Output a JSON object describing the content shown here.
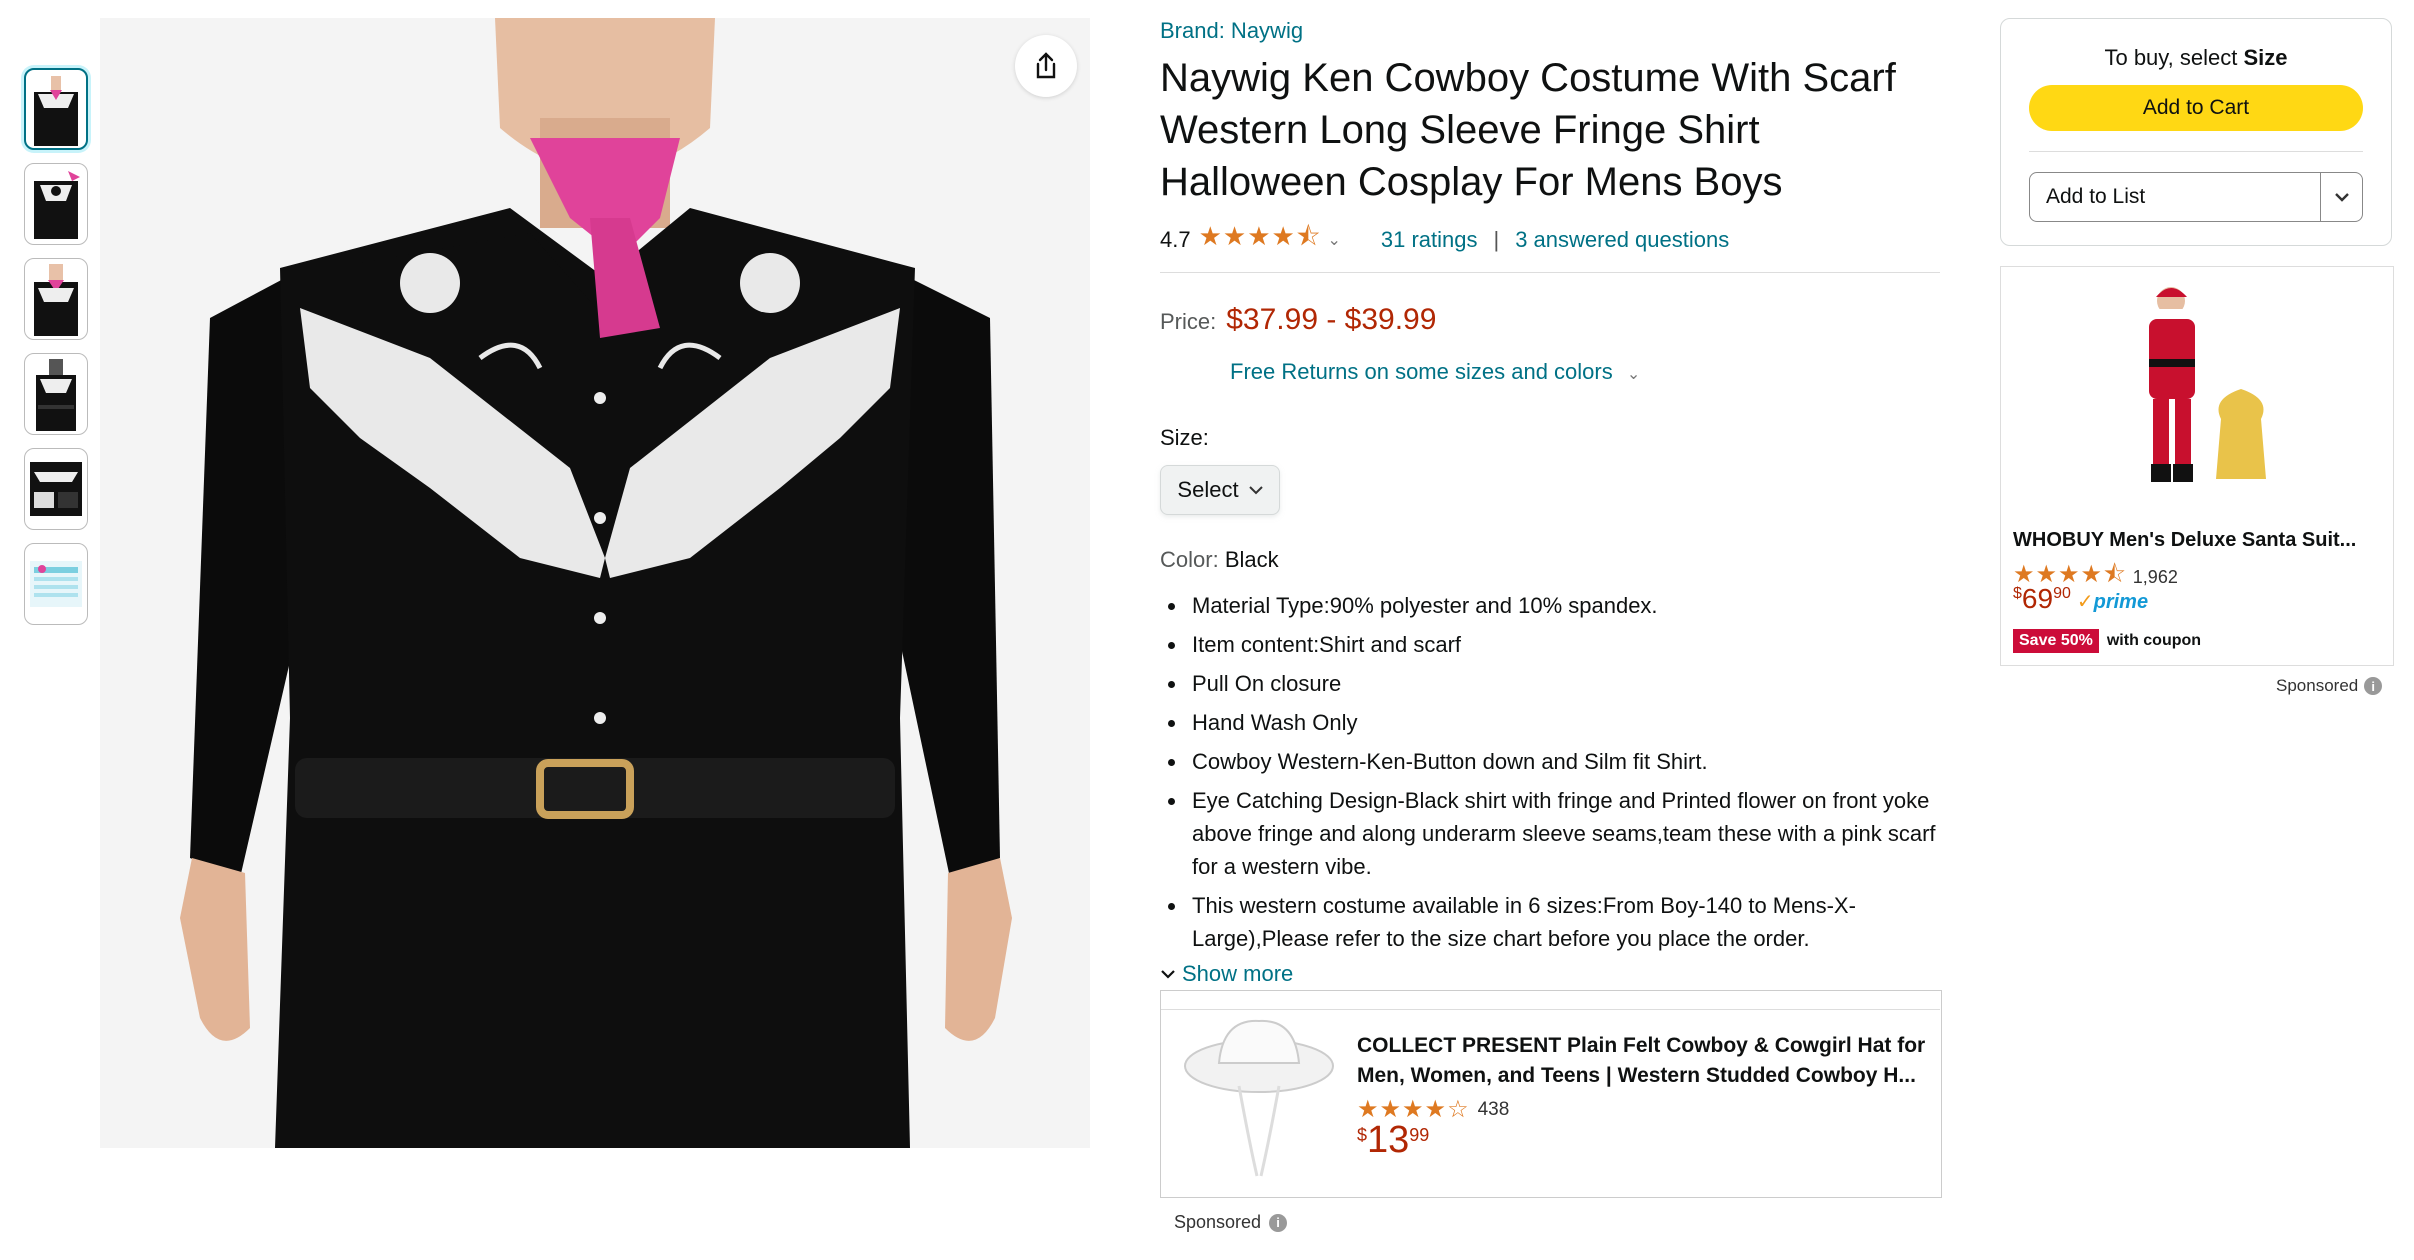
{
  "product": {
    "brand": "Brand: Naywig",
    "title": "Naywig Ken Cowboy Costume With Scarf Western Long Sleeve Fringe Shirt Halloween Cosplay For Mens Boys",
    "rating_value": "4.7",
    "stars": "★★★★⯪",
    "ratings_link": "31 ratings",
    "separator": "|",
    "questions_link": "3 answered questions",
    "price_label": "Price:",
    "price": "$37.99 - $39.99",
    "free_returns": "Free Returns on some sizes and colors",
    "size_label": "Size:",
    "size_select": "Select",
    "color_label": "Color:",
    "color_value": "Black",
    "bullets": [
      "Material Type:90% polyester and 10% spandex.",
      "Item content:Shirt and scarf",
      "Pull On closure",
      "Hand Wash Only",
      "Cowboy Western-Ken-Button down and Silm fit Shirt.",
      "Eye Catching Design-Black shirt with fringe and Printed flower on front yoke above fringe and along underarm sleeve seams,team these with a pink scarf for a western vibe.",
      "This western costume available in 6 sizes:From Boy-140 to Mens-X-Large),Please refer to the size chart before you place the order."
    ],
    "show_more": "Show more"
  },
  "sponsored_product": {
    "title": "COLLECT PRESENT Plain Felt Cowboy & Cowgirl Hat for Men, Women, and Teens | Western Studded Cowboy H...",
    "stars": "★★★★☆",
    "rating_count": "438",
    "price_currency": "$",
    "price_whole": "13",
    "price_fraction": "99",
    "sponsored_label": "Sponsored",
    "info_icon": "i"
  },
  "buybox": {
    "to_buy_prefix": "To buy, select",
    "to_buy_bold": "Size",
    "add_to_cart": "Add to Cart",
    "add_to_list": "Add to List"
  },
  "side_ad": {
    "title": "WHOBUY Men's Deluxe Santa Suit...",
    "stars": "★★★★⯪",
    "rating_count": "1,962",
    "price_currency": "$",
    "price_whole": "69",
    "price_fraction": "90",
    "prime": "prime",
    "prime_check": "✓",
    "coupon_badge": "Save 50%",
    "coupon_text": "with coupon",
    "sponsored_label": "Sponsored",
    "info_icon": "i"
  },
  "colors": {
    "link": "#007185",
    "price": "#b12704",
    "add_to_cart": "#ffd814",
    "stars": "#de7921",
    "coupon": "#cc0c39",
    "prime": "#1399d6"
  }
}
